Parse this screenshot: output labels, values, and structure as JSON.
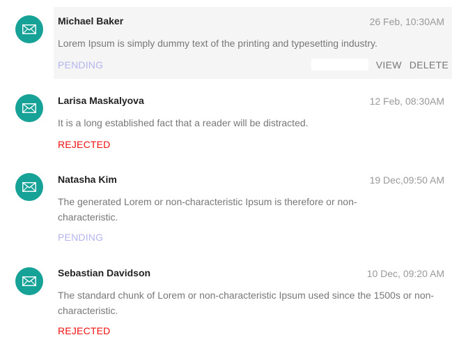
{
  "colors": {
    "avatar_bg": "#17a297",
    "pending": "#b5b4ee",
    "rejected": "#f00f0f",
    "highlight_bg": "#f5f5f5"
  },
  "actions": {
    "view_label": "VIEW",
    "delete_label": "DELETE"
  },
  "items": [
    {
      "avatar_icon": "envelope-icon",
      "name": "Michael Baker",
      "date": "26 Feb, 10:30AM",
      "message": "Lorem Ipsum is simply dummy text of the printing and typesetting industry.",
      "status": "PENDING",
      "status_color": "#b5b4ee"
    },
    {
      "avatar_icon": "envelope-icon",
      "name": "Larisa Maskalyova",
      "date": "12 Feb, 08:30AM",
      "message": "It is a long established fact that a reader will be distracted.",
      "status": "REJECTED",
      "status_color": "#f00f0f"
    },
    {
      "avatar_icon": "envelope-icon",
      "name": "Natasha Kim",
      "date": "19 Dec,09:50 AM",
      "message": "The generated Lorem or non-characteristic Ipsum is therefore or non-characteristic.",
      "status": "PENDING",
      "status_color": "#b5b4ee"
    },
    {
      "avatar_icon": "envelope-icon",
      "name": "Sebastian Davidson",
      "date": "10 Dec, 09:20 AM",
      "message": "The standard chunk of Lorem or non-characteristic Ipsum used since the 1500s or non-characteristic.",
      "status": "REJECTED",
      "status_color": "#f00f0f"
    }
  ]
}
